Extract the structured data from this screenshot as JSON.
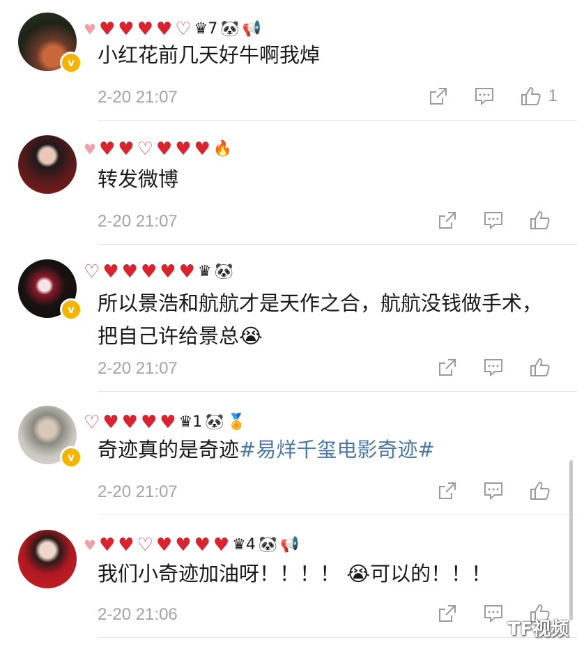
{
  "comments": [
    {
      "text": "小红花前几天好牛啊我焯",
      "time": "2-20 21:07",
      "like_count": "1",
      "badges": [
        "♛7",
        "🐼",
        "📢"
      ]
    },
    {
      "text": "转发微博",
      "time": "2-20 21:07",
      "like_count": "",
      "badges": [
        "🔥"
      ]
    },
    {
      "text": "所以景浩和航航才是天作之合，航航没钱做手术，把自己许给景总😭",
      "time": "2-20 21:07",
      "like_count": "",
      "badges": [
        "♛",
        "🐼"
      ]
    },
    {
      "text_plain": "奇迹真的是奇迹",
      "hashtag": "#易烊千玺电影奇迹#",
      "time": "2-20 21:07",
      "like_count": "",
      "badges": [
        "♛1",
        "🐼",
        "🏅"
      ]
    },
    {
      "text": "我们小奇迹加油呀！！！！ 😭可以的！！！",
      "time": "2-20 21:06",
      "like_count": "",
      "badges": [
        "♛4",
        "🐼",
        "📢"
      ]
    }
  ],
  "verified_badge": "v",
  "watermark": "TF视频",
  "icons": [
    "share-icon",
    "comment-icon",
    "like-icon"
  ],
  "colors": {
    "hashtag": "#4a78a8",
    "heart": "#d9232f",
    "verified": "#f4b400",
    "meta": "#a4a4a4"
  }
}
